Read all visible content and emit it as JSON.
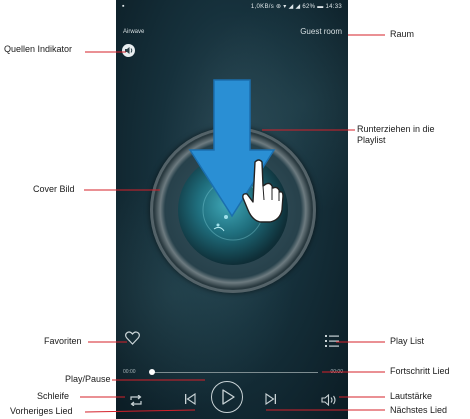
{
  "status_bar": {
    "left": "▪",
    "right": "1,0KB/s ⊛ ▾ ◢ ◢ 62% ▬ 14:33"
  },
  "header": {
    "source_name": "Airwave",
    "room_name": "Guest room"
  },
  "player": {
    "time_elapsed": "00:00",
    "time_total": "00:00",
    "progress": 0.0
  },
  "annotations": {
    "quellen_indikator": "Quellen Indikator",
    "raum": "Raum",
    "runterziehen": "Runterziehen in die Playlist",
    "cover_bild": "Cover Bild",
    "favoriten": "Favoriten",
    "play_list": "Play List",
    "fortschritt_lied": "Fortschritt Lied",
    "play_pause": "Play/Pause",
    "schleife": "Schleife",
    "lautstaerke": "Lautstärke",
    "vorheriges_lied": "Vorheriges Lied",
    "naechstes_lied": "Nächstes Lied"
  },
  "icons": {
    "source": "speaker-icon",
    "favorite": "heart-icon",
    "playlist": "list-icon",
    "loop": "repeat-icon",
    "previous": "skip-previous-icon",
    "play": "play-icon",
    "next": "skip-next-icon",
    "volume": "volume-icon",
    "drag": "arrow-down-icon"
  },
  "colors": {
    "annotation_line": "#d4202a",
    "drag_arrow": "#2a8fd4"
  }
}
